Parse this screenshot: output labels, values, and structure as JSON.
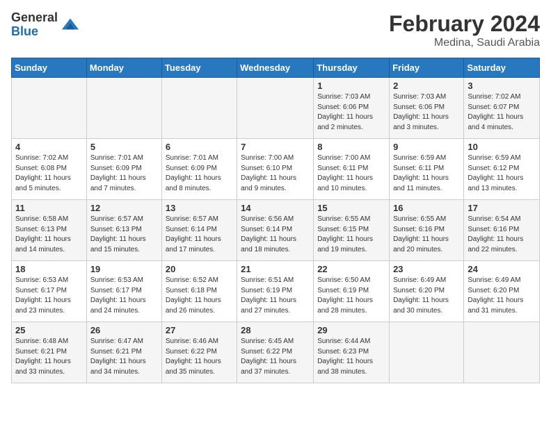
{
  "header": {
    "logo_line1": "General",
    "logo_line2": "Blue",
    "month_year": "February 2024",
    "location": "Medina, Saudi Arabia"
  },
  "days_of_week": [
    "Sunday",
    "Monday",
    "Tuesday",
    "Wednesday",
    "Thursday",
    "Friday",
    "Saturday"
  ],
  "weeks": [
    [
      {
        "num": "",
        "info": ""
      },
      {
        "num": "",
        "info": ""
      },
      {
        "num": "",
        "info": ""
      },
      {
        "num": "",
        "info": ""
      },
      {
        "num": "1",
        "info": "Sunrise: 7:03 AM\nSunset: 6:06 PM\nDaylight: 11 hours and 2 minutes."
      },
      {
        "num": "2",
        "info": "Sunrise: 7:03 AM\nSunset: 6:06 PM\nDaylight: 11 hours and 3 minutes."
      },
      {
        "num": "3",
        "info": "Sunrise: 7:02 AM\nSunset: 6:07 PM\nDaylight: 11 hours and 4 minutes."
      }
    ],
    [
      {
        "num": "4",
        "info": "Sunrise: 7:02 AM\nSunset: 6:08 PM\nDaylight: 11 hours and 5 minutes."
      },
      {
        "num": "5",
        "info": "Sunrise: 7:01 AM\nSunset: 6:09 PM\nDaylight: 11 hours and 7 minutes."
      },
      {
        "num": "6",
        "info": "Sunrise: 7:01 AM\nSunset: 6:09 PM\nDaylight: 11 hours and 8 minutes."
      },
      {
        "num": "7",
        "info": "Sunrise: 7:00 AM\nSunset: 6:10 PM\nDaylight: 11 hours and 9 minutes."
      },
      {
        "num": "8",
        "info": "Sunrise: 7:00 AM\nSunset: 6:11 PM\nDaylight: 11 hours and 10 minutes."
      },
      {
        "num": "9",
        "info": "Sunrise: 6:59 AM\nSunset: 6:11 PM\nDaylight: 11 hours and 11 minutes."
      },
      {
        "num": "10",
        "info": "Sunrise: 6:59 AM\nSunset: 6:12 PM\nDaylight: 11 hours and 13 minutes."
      }
    ],
    [
      {
        "num": "11",
        "info": "Sunrise: 6:58 AM\nSunset: 6:13 PM\nDaylight: 11 hours and 14 minutes."
      },
      {
        "num": "12",
        "info": "Sunrise: 6:57 AM\nSunset: 6:13 PM\nDaylight: 11 hours and 15 minutes."
      },
      {
        "num": "13",
        "info": "Sunrise: 6:57 AM\nSunset: 6:14 PM\nDaylight: 11 hours and 17 minutes."
      },
      {
        "num": "14",
        "info": "Sunrise: 6:56 AM\nSunset: 6:14 PM\nDaylight: 11 hours and 18 minutes."
      },
      {
        "num": "15",
        "info": "Sunrise: 6:55 AM\nSunset: 6:15 PM\nDaylight: 11 hours and 19 minutes."
      },
      {
        "num": "16",
        "info": "Sunrise: 6:55 AM\nSunset: 6:16 PM\nDaylight: 11 hours and 20 minutes."
      },
      {
        "num": "17",
        "info": "Sunrise: 6:54 AM\nSunset: 6:16 PM\nDaylight: 11 hours and 22 minutes."
      }
    ],
    [
      {
        "num": "18",
        "info": "Sunrise: 6:53 AM\nSunset: 6:17 PM\nDaylight: 11 hours and 23 minutes."
      },
      {
        "num": "19",
        "info": "Sunrise: 6:53 AM\nSunset: 6:17 PM\nDaylight: 11 hours and 24 minutes."
      },
      {
        "num": "20",
        "info": "Sunrise: 6:52 AM\nSunset: 6:18 PM\nDaylight: 11 hours and 26 minutes."
      },
      {
        "num": "21",
        "info": "Sunrise: 6:51 AM\nSunset: 6:19 PM\nDaylight: 11 hours and 27 minutes."
      },
      {
        "num": "22",
        "info": "Sunrise: 6:50 AM\nSunset: 6:19 PM\nDaylight: 11 hours and 28 minutes."
      },
      {
        "num": "23",
        "info": "Sunrise: 6:49 AM\nSunset: 6:20 PM\nDaylight: 11 hours and 30 minutes."
      },
      {
        "num": "24",
        "info": "Sunrise: 6:49 AM\nSunset: 6:20 PM\nDaylight: 11 hours and 31 minutes."
      }
    ],
    [
      {
        "num": "25",
        "info": "Sunrise: 6:48 AM\nSunset: 6:21 PM\nDaylight: 11 hours and 33 minutes."
      },
      {
        "num": "26",
        "info": "Sunrise: 6:47 AM\nSunset: 6:21 PM\nDaylight: 11 hours and 34 minutes."
      },
      {
        "num": "27",
        "info": "Sunrise: 6:46 AM\nSunset: 6:22 PM\nDaylight: 11 hours and 35 minutes."
      },
      {
        "num": "28",
        "info": "Sunrise: 6:45 AM\nSunset: 6:22 PM\nDaylight: 11 hours and 37 minutes."
      },
      {
        "num": "29",
        "info": "Sunrise: 6:44 AM\nSunset: 6:23 PM\nDaylight: 11 hours and 38 minutes."
      },
      {
        "num": "",
        "info": ""
      },
      {
        "num": "",
        "info": ""
      }
    ]
  ]
}
